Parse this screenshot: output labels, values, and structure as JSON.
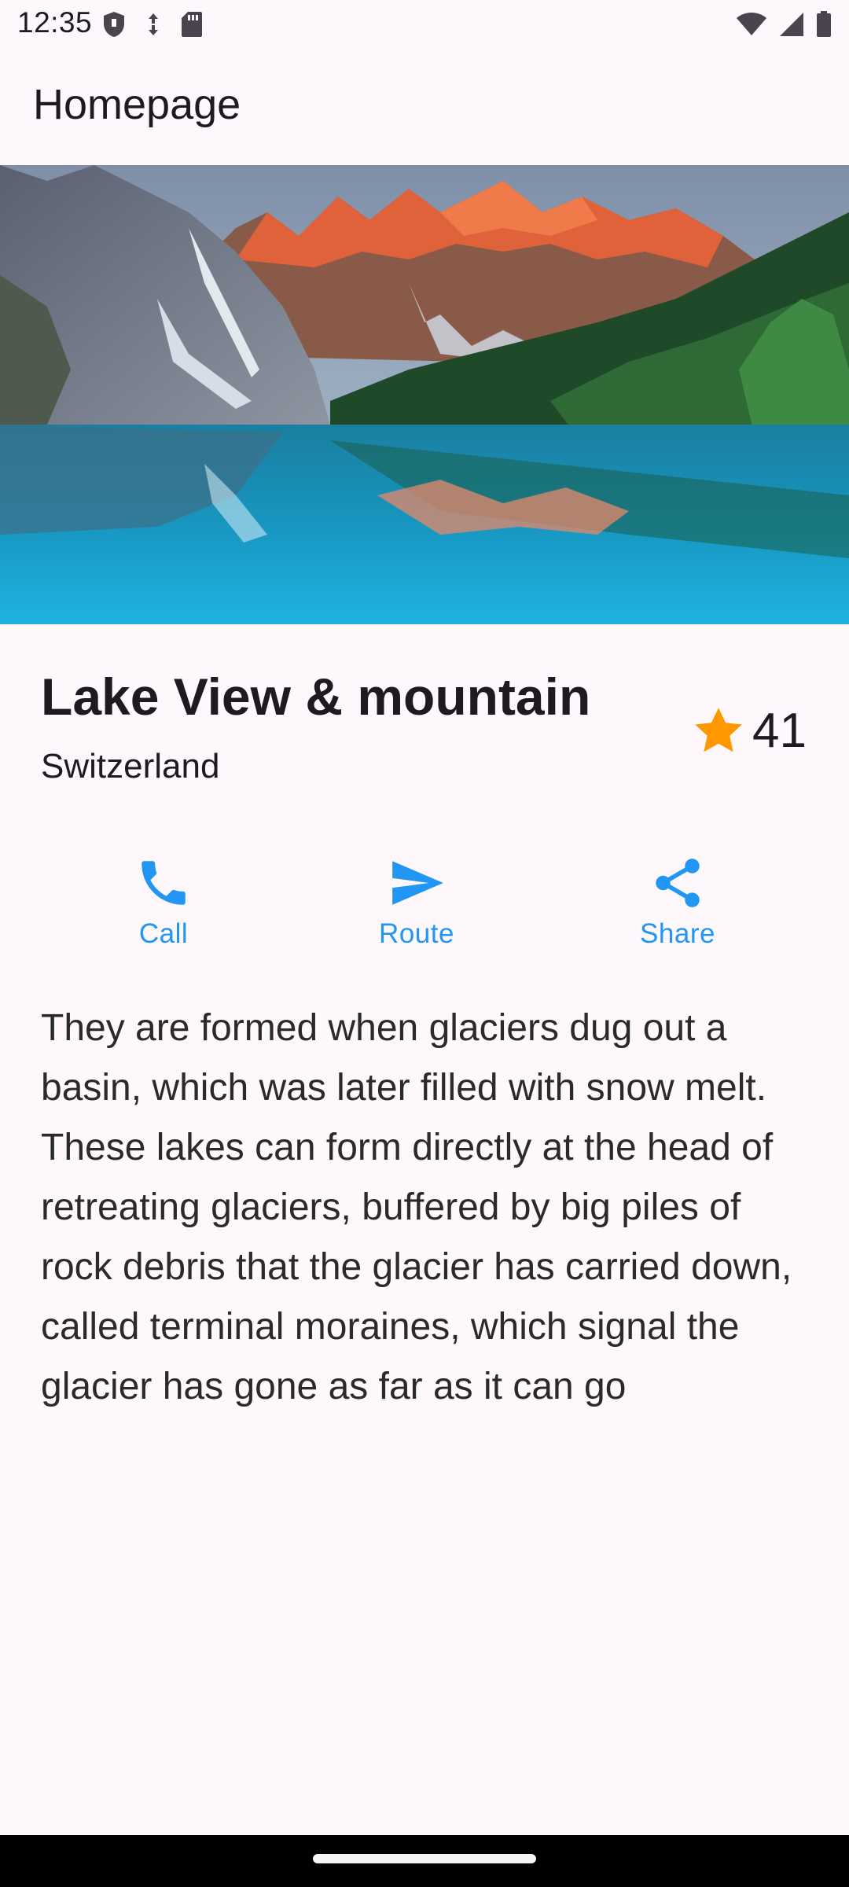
{
  "status_bar": {
    "time": "12:35",
    "left_icons": [
      "shield-icon",
      "data-saver-icon",
      "sd-card-icon"
    ],
    "right_icons": [
      "wifi-icon",
      "cell-signal-icon",
      "battery-icon"
    ]
  },
  "app_bar": {
    "title": "Homepage"
  },
  "hero": {
    "image": "lake-mountain-photo"
  },
  "place": {
    "title": "Lake View & mountain",
    "subtitle": "Switzerland",
    "rating_count": "41",
    "rating_icon": "star-icon"
  },
  "actions": [
    {
      "label": "Call",
      "icon": "phone-icon"
    },
    {
      "label": "Route",
      "icon": "send-icon"
    },
    {
      "label": "Share",
      "icon": "share-icon"
    }
  ],
  "description": "They are formed when glaciers dug out a basin, which was later filled with snow melt. These lakes can form directly at the head of retreating glaciers, buffered by big piles of rock debris that the glacier has carried down, called terminal moraines, which signal the glacier has gone as far as it can go",
  "colors": {
    "accent": "#2196f3",
    "star": "#ff9800",
    "background": "#fef7fb",
    "text": "#1d1b20"
  }
}
